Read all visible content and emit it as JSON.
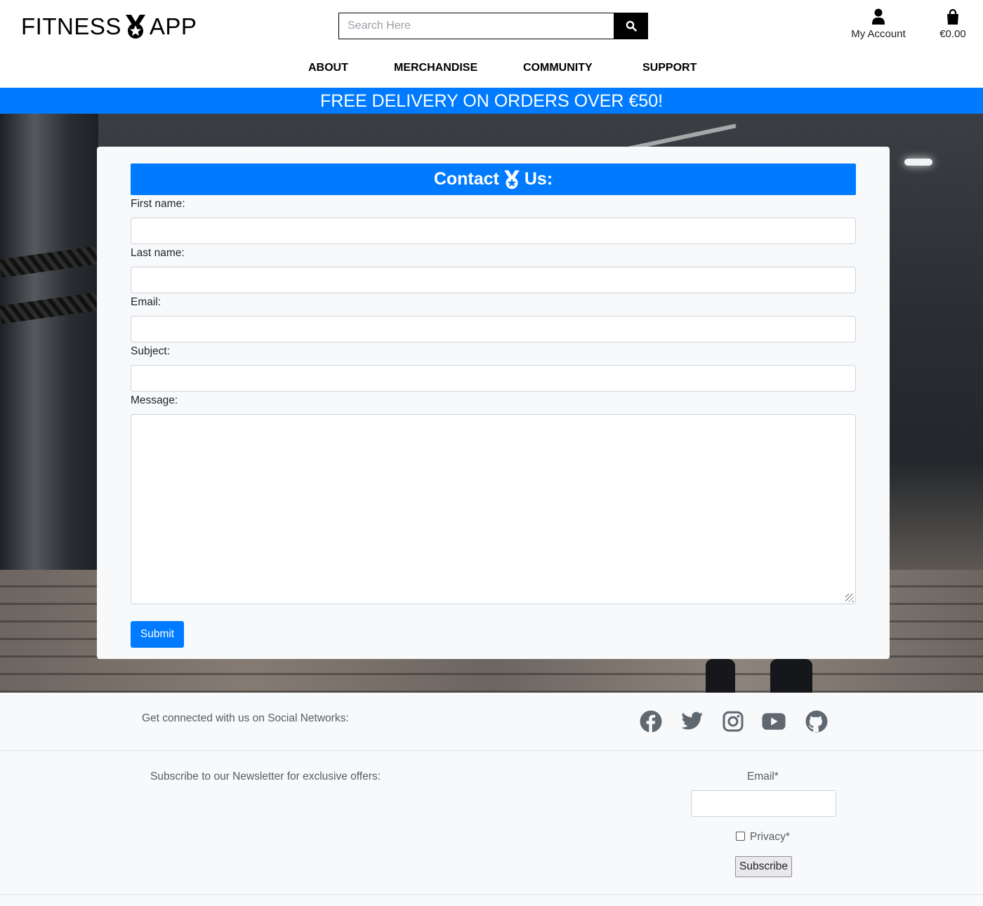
{
  "brand": {
    "name_left": "FITNESS",
    "name_right": "APP"
  },
  "search": {
    "placeholder": "Search Here"
  },
  "account": {
    "label": "My Account"
  },
  "cart": {
    "total": "€0.00"
  },
  "nav": {
    "items": [
      "ABOUT",
      "MERCHANDISE",
      "COMMUNITY",
      "SUPPORT"
    ]
  },
  "banner": {
    "text": "FREE DELIVERY ON ORDERS OVER €50!"
  },
  "contact": {
    "title_left": "Contact",
    "title_right": "Us:",
    "fields": [
      "First name:",
      "Last name:",
      "Email:",
      "Subject:",
      "Message:"
    ],
    "submit": "Submit"
  },
  "footer": {
    "social_text": "Get connected with us on Social Networks:",
    "social_icons": [
      "facebook-icon",
      "twitter-icon",
      "instagram-icon",
      "youtube-icon",
      "github-icon"
    ],
    "newsletter_text": "Subscribe to our Newsletter for exclusive offers:",
    "email_label": "Email*",
    "privacy_label": "Privacy*",
    "subscribe": "Subscribe"
  },
  "colors": {
    "accent": "#007bff",
    "footer_bg": "#f8f9fa",
    "icon_gray": "#5f6870"
  }
}
